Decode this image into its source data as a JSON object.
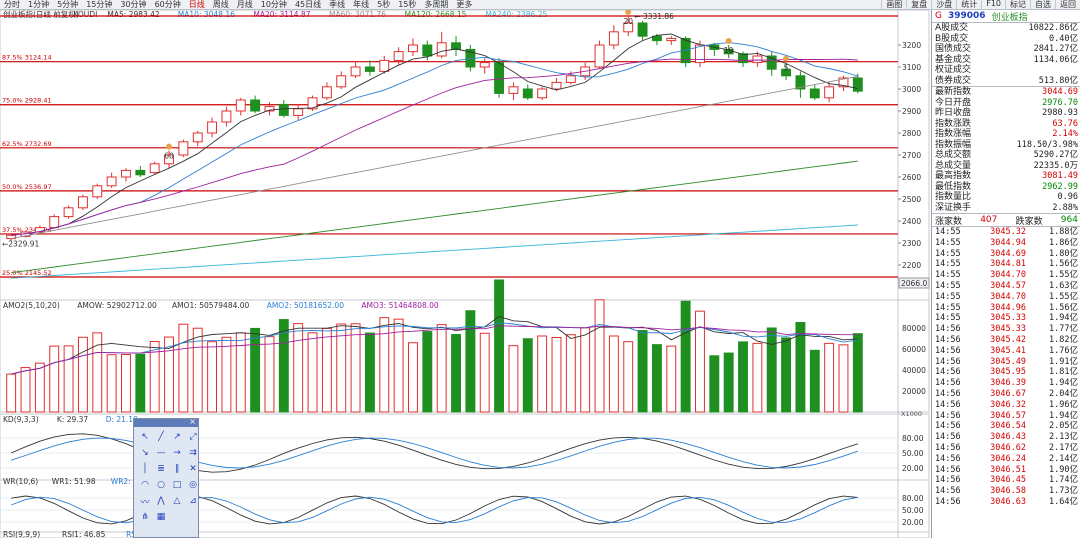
{
  "top_tabs": [
    "分时",
    "1分钟",
    "5分钟",
    "15分钟",
    "30分钟",
    "60分钟",
    "日线",
    "周线",
    "月线",
    "10分钟",
    "45日线",
    "季线",
    "年线",
    "5秒",
    "15秒",
    "多周期",
    "更多"
  ],
  "active_tab": "日线",
  "right_tabs": [
    "画图",
    "复盘",
    "沙盘",
    "统计",
    "F10",
    "标记",
    "自选",
    "返回"
  ],
  "main_legend": {
    "title": "创业板指(日线 前复权)",
    "indicator": "KOUDI",
    "ma5": "MA5: 2983.42",
    "ma10": "MA10: 3048.16",
    "ma20": "MA20: 3114.87",
    "ma60": "MA60: 3071.76",
    "ma120": "MA120: 2668.15",
    "ma240": "MA240: 2386.25"
  },
  "colors": {
    "up": "#e03030",
    "down": "#1f8f1f",
    "ma5": "#333333",
    "ma10": "#2a7fd4",
    "ma20": "#a020a0",
    "ma60": "#909090",
    "ma120": "#2a8a2a",
    "ma240": "#35b6d8",
    "fib": "#cc0000"
  },
  "fib_lines": [
    {
      "label": "87.5% 3124.14",
      "price": 3124.14
    },
    {
      "label": "75.0% 2928.41",
      "price": 2928.41
    },
    {
      "label": "62.5% 2732.69",
      "price": 2732.69
    },
    {
      "label": "50.0% 2536.97",
      "price": 2536.97
    },
    {
      "label": "37.5% 2341.24",
      "price": 2341.24
    },
    {
      "label": "25.0% 2145.52",
      "price": 2145.52
    }
  ],
  "top_line_price": 3331.86,
  "high_label": "3331.86",
  "low_label": "2329.91",
  "price_axis": [
    "3200",
    "3100",
    "3000",
    "2900",
    "2800",
    "2700",
    "2600",
    "2500",
    "2400",
    "2300",
    "2200"
  ],
  "price_axis_values": [
    3200,
    3100,
    3000,
    2900,
    2800,
    2700,
    2600,
    2500,
    2400,
    2300,
    2200
  ],
  "price_range": [
    2050,
    3350
  ],
  "price_box": "2066.0",
  "markers": [
    {
      "label": "60",
      "bar": 11
    },
    {
      "label": "20",
      "bar": 43
    },
    {
      "label": "10",
      "bar": 50
    },
    {
      "label": "5",
      "bar": 54
    }
  ],
  "candles": [
    [
      2320,
      2335,
      2310,
      2340
    ],
    [
      2330,
      2350,
      2325,
      2355
    ],
    [
      2350,
      2370,
      2340,
      2380
    ],
    [
      2370,
      2420,
      2365,
      2430
    ],
    [
      2420,
      2460,
      2410,
      2470
    ],
    [
      2460,
      2510,
      2450,
      2520
    ],
    [
      2510,
      2560,
      2500,
      2570
    ],
    [
      2560,
      2600,
      2550,
      2620
    ],
    [
      2600,
      2630,
      2580,
      2640
    ],
    [
      2630,
      2610,
      2600,
      2650
    ],
    [
      2620,
      2660,
      2610,
      2670
    ],
    [
      2660,
      2700,
      2640,
      2720
    ],
    [
      2700,
      2760,
      2690,
      2770
    ],
    [
      2760,
      2800,
      2740,
      2810
    ],
    [
      2800,
      2850,
      2780,
      2870
    ],
    [
      2850,
      2900,
      2830,
      2920
    ],
    [
      2900,
      2950,
      2880,
      2960
    ],
    [
      2950,
      2900,
      2890,
      2970
    ],
    [
      2900,
      2920,
      2880,
      2940
    ],
    [
      2930,
      2880,
      2870,
      2950
    ],
    [
      2880,
      2910,
      2860,
      2930
    ],
    [
      2910,
      2960,
      2900,
      2970
    ],
    [
      2960,
      3010,
      2950,
      3030
    ],
    [
      3010,
      3060,
      3000,
      3080
    ],
    [
      3060,
      3100,
      3050,
      3120
    ],
    [
      3100,
      3080,
      3060,
      3130
    ],
    [
      3080,
      3130,
      3070,
      3150
    ],
    [
      3130,
      3170,
      3110,
      3190
    ],
    [
      3170,
      3200,
      3150,
      3230
    ],
    [
      3200,
      3150,
      3130,
      3220
    ],
    [
      3150,
      3210,
      3140,
      3260
    ],
    [
      3210,
      3180,
      3150,
      3240
    ],
    [
      3180,
      3100,
      3080,
      3200
    ],
    [
      3100,
      3120,
      3070,
      3140
    ],
    [
      3120,
      2980,
      2960,
      3140
    ],
    [
      2980,
      3010,
      2950,
      3030
    ],
    [
      3000,
      2960,
      2950,
      3020
    ],
    [
      2960,
      3000,
      2950,
      3010
    ],
    [
      3000,
      3030,
      2990,
      3050
    ],
    [
      3030,
      3060,
      3020,
      3080
    ],
    [
      3060,
      3100,
      3040,
      3120
    ],
    [
      3100,
      3200,
      3090,
      3220
    ],
    [
      3200,
      3260,
      3180,
      3290
    ],
    [
      3260,
      3300,
      3240,
      3332
    ],
    [
      3300,
      3240,
      3220,
      3310
    ],
    [
      3240,
      3220,
      3200,
      3250
    ],
    [
      3220,
      3230,
      3200,
      3240
    ],
    [
      3230,
      3120,
      3100,
      3240
    ],
    [
      3120,
      3200,
      3100,
      3220
    ],
    [
      3200,
      3180,
      3150,
      3210
    ],
    [
      3180,
      3160,
      3140,
      3200
    ],
    [
      3160,
      3120,
      3100,
      3170
    ],
    [
      3120,
      3150,
      3100,
      3170
    ],
    [
      3150,
      3090,
      3060,
      3170
    ],
    [
      3090,
      3060,
      3040,
      3120
    ],
    [
      3060,
      3000,
      2960,
      3080
    ],
    [
      3000,
      2960,
      2950,
      3020
    ],
    [
      2960,
      3010,
      2940,
      3030
    ],
    [
      3010,
      3050,
      2990,
      3060
    ],
    [
      3050,
      2990,
      2980,
      3070
    ]
  ],
  "amo_legend": {
    "name": "AMO2(5,10,20)",
    "amow": "AMOW: 52902712.00",
    "amo1": "AMO1: 50579484.00",
    "amo2": "AMO2: 50181652.00",
    "amo3": "AMO3: 51464808.00"
  },
  "amo_axis": [
    "80000",
    "60000",
    "40000",
    "20000"
  ],
  "amo_axis_values": [
    80000,
    60000,
    40000,
    20000
  ],
  "amo_range": [
    0,
    95000
  ],
  "amo_unit": "X1000",
  "kd_legend": {
    "name": "KD(9,3,3)",
    "k": "K: 29.37",
    "d": "D: 21.10"
  },
  "kd_axis": [
    "80.00",
    "50.00",
    "20.00"
  ],
  "kd_axis_values": [
    80,
    50,
    20
  ],
  "wr_legend": {
    "name": "WR(10,6)",
    "wr1": "WR1: 51.98",
    "wr2": "WR2: 37.74"
  },
  "wr_axis": [
    "80.00",
    "50.00",
    "20.00"
  ],
  "wr_axis_values": [
    80,
    50,
    20
  ],
  "rsi_legend": {
    "name": "RSI(9,9,9)",
    "rsi1": "RSI1: 46.85",
    "rsi2": "RSI2: 46.85"
  },
  "side": {
    "g": "G",
    "code": "399006",
    "name": "创业板指",
    "rows1": [
      {
        "k": "A股成交",
        "v": "10822.86亿",
        "c": ""
      },
      {
        "k": "B股成交",
        "v": "0.40亿",
        "c": ""
      },
      {
        "k": "国债成交",
        "v": "2841.27亿",
        "c": ""
      },
      {
        "k": "基金成交",
        "v": "1134.06亿",
        "c": ""
      },
      {
        "k": "权证成交",
        "v": "",
        "c": ""
      },
      {
        "k": "债券成交",
        "v": "513.80亿",
        "c": ""
      }
    ],
    "rows2": [
      {
        "k": "最新指数",
        "v": "3044.69",
        "c": "red"
      },
      {
        "k": "今日开盘",
        "v": "2976.70",
        "c": "green"
      },
      {
        "k": "昨日收盘",
        "v": "2980.93",
        "c": ""
      },
      {
        "k": "指数涨跌",
        "v": "63.76",
        "c": "red"
      },
      {
        "k": "指数涨幅",
        "v": "2.14%",
        "c": "red"
      },
      {
        "k": "指数振幅",
        "v": "118.50/3.98%",
        "c": ""
      },
      {
        "k": "总成交额",
        "v": "5290.27亿",
        "c": ""
      },
      {
        "k": "总成交量",
        "v": "22335.0万",
        "c": ""
      },
      {
        "k": "最高指数",
        "v": "3081.49",
        "c": "red"
      },
      {
        "k": "最低指数",
        "v": "2962.99",
        "c": "green"
      },
      {
        "k": "指数量比",
        "v": "0.96",
        "c": ""
      },
      {
        "k": "深证换手",
        "v": "2.88%",
        "c": ""
      }
    ],
    "up_label": "涨家数",
    "up_val": "407",
    "down_label": "跌家数",
    "down_val": "964",
    "ticks": [
      [
        "14:55",
        "3045.32",
        "1.88亿"
      ],
      [
        "14:55",
        "3044.94",
        "1.86亿"
      ],
      [
        "14:55",
        "3044.69",
        "1.80亿"
      ],
      [
        "14:55",
        "3044.81",
        "1.56亿"
      ],
      [
        "14:55",
        "3044.70",
        "1.55亿"
      ],
      [
        "14:55",
        "3044.57",
        "1.63亿"
      ],
      [
        "14:55",
        "3044.70",
        "1.55亿"
      ],
      [
        "14:55",
        "3044.96",
        "1.56亿"
      ],
      [
        "14:55",
        "3045.33",
        "1.94亿"
      ],
      [
        "14:56",
        "3045.33",
        "1.77亿"
      ],
      [
        "14:56",
        "3045.42",
        "1.82亿"
      ],
      [
        "14:56",
        "3045.41",
        "1.76亿"
      ],
      [
        "14:56",
        "3045.49",
        "1.91亿"
      ],
      [
        "14:56",
        "3045.95",
        "1.81亿"
      ],
      [
        "14:56",
        "3046.39",
        "1.94亿"
      ],
      [
        "14:56",
        "3046.67",
        "2.04亿"
      ],
      [
        "14:56",
        "3046.32",
        "1.96亿"
      ],
      [
        "14:56",
        "3046.57",
        "1.94亿"
      ],
      [
        "14:56",
        "3046.54",
        "2.05亿"
      ],
      [
        "14:56",
        "3046.43",
        "2.13亿"
      ],
      [
        "14:56",
        "3046.62",
        "2.17亿"
      ],
      [
        "14:56",
        "3046.24",
        "2.14亿"
      ],
      [
        "14:56",
        "3046.51",
        "1.90亿"
      ],
      [
        "14:56",
        "3046.45",
        "1.74亿"
      ],
      [
        "14:56",
        "3046.58",
        "1.73亿"
      ],
      [
        "14:56",
        "3046.63",
        "1.64亿"
      ]
    ]
  }
}
